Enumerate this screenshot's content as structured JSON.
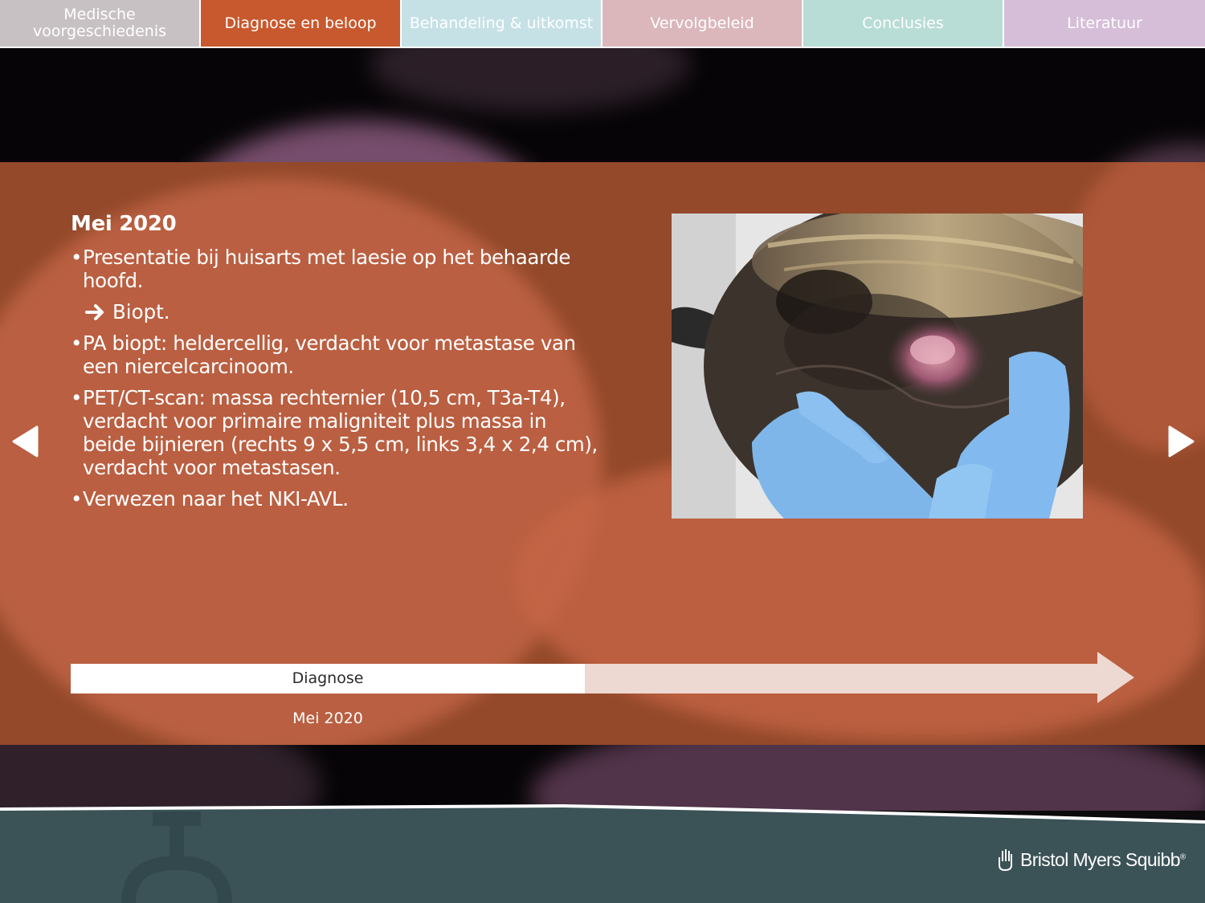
{
  "tabs": [
    {
      "label": "Medische\nvoorgeschiedenis",
      "color": "#c8c1c4",
      "active": false
    },
    {
      "label": "Diagnose en beloop",
      "color": "#c8592e",
      "active": true
    },
    {
      "label": "Behandeling & uitkomst",
      "color": "#c6e1e6",
      "active": false
    },
    {
      "label": "Vervolgbeleid",
      "color": "#dbb7bb",
      "active": false
    },
    {
      "label": "Conclusies",
      "color": "#b8dcd6",
      "active": false
    },
    {
      "label": "Literatuur",
      "color": "#d6bed8",
      "active": false
    }
  ],
  "content": {
    "date_heading": "Mei 2020",
    "bullets": [
      "Presentatie bij huisarts met laesie op het behaarde hoofd.",
      "PA biopt: heldercellig, verdacht voor metastase van een niercelcarcinoom.",
      "PET/CT-scan: massa rechternier (10,5 cm, T3a-T4), verdacht voor primaire maligniteit plus massa in beide bijnieren (rechts 9 x 5,5 cm, links 3,4 x 2,4 cm), verdacht voor metastasen.",
      "Verwezen naar het NKI-AVL."
    ],
    "sub_step": "Biopt.",
    "bullet_symbol": "•"
  },
  "photo": {
    "icon": "scalp-lesion-photo"
  },
  "timeline": {
    "label": "Diagnose",
    "date": "Mei 2020",
    "progress": 0.5
  },
  "nav": {
    "prev_icon": "triangle-left-icon",
    "next_icon": "triangle-right-icon"
  },
  "footer": {
    "brand": "Bristol Myers Squibb",
    "trademark": "®"
  },
  "colors": {
    "panel": "#93492a",
    "footer": "#3b5257",
    "active_tab": "#c8592e"
  }
}
